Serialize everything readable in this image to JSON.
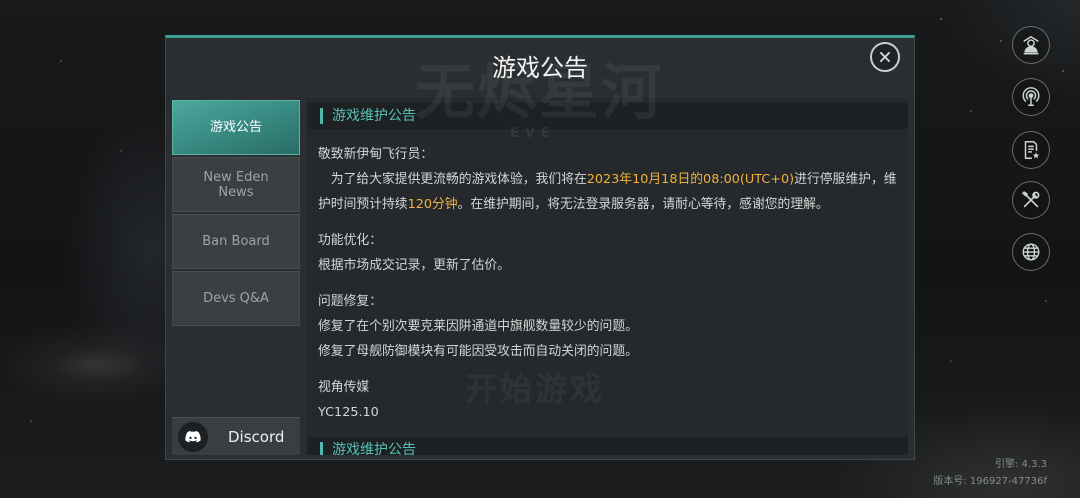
{
  "background": {
    "logo_text": "无烬星河",
    "logo_subtext": "EVE",
    "start_button_label": "开始游戏"
  },
  "dialog": {
    "title": "游戏公告",
    "tabs": [
      {
        "label": "游戏公告",
        "active": true
      },
      {
        "label": "New Eden News",
        "active": false
      },
      {
        "label": "Ban Board",
        "active": false
      },
      {
        "label": "Devs Q&A",
        "active": false
      }
    ],
    "discord": {
      "label": "Discord",
      "icon": "discord-icon"
    },
    "announcement": {
      "header": "游戏维护公告",
      "greeting": "敬致新伊甸飞行员：",
      "intro": [
        {
          "text": "为了给大家提供更流畅的游戏体验，我们将在",
          "highlight": false
        },
        {
          "text": "2023年10月18日的08:00(UTC+0)",
          "highlight": true
        },
        {
          "text": "进行停服维护，维护时间预计持续",
          "highlight": false
        },
        {
          "text": "120分钟",
          "highlight": true
        },
        {
          "text": "。在维护期间，将无法登录服务器，请耐心等待，感谢您的理解。",
          "highlight": false
        }
      ],
      "sections": [
        {
          "heading": "功能优化：",
          "items": [
            "根据市场成交记录，更新了估价。"
          ]
        },
        {
          "heading": "问题修复：",
          "items": [
            "修复了在个别次要克莱因阱通道中旗舰数量较少的问题。",
            "修复了母舰防御模块有可能因受攻击而自动关闭的问题。"
          ]
        }
      ],
      "signature": "视角传媒",
      "date": "YC125.10",
      "next_header": "游戏维护公告"
    }
  },
  "side_menu": [
    {
      "icon": "pilot-profile-icon"
    },
    {
      "icon": "broadcast-icon"
    },
    {
      "icon": "notes-star-icon"
    },
    {
      "icon": "tools-icon"
    },
    {
      "icon": "globe-icon"
    }
  ],
  "build_info": {
    "engine": "引擎: 4.3.3",
    "version": "版本号: 196927-47736f"
  },
  "colors": {
    "accent": "#3a9e93",
    "accent_text": "#58c0b3",
    "highlight": "#f0b13d",
    "body_text": "#d4d6d7"
  }
}
